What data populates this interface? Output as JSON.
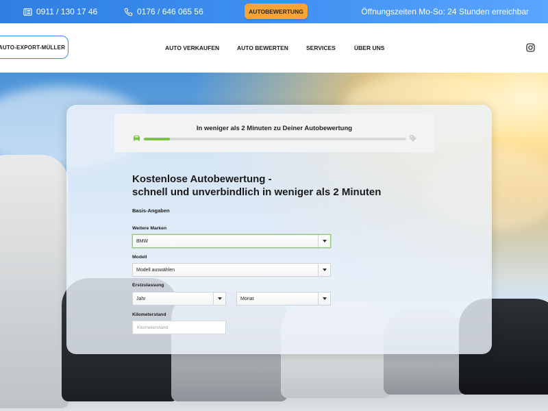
{
  "topbar": {
    "phone1": "0911 / 130 17 46",
    "phone2": "0176 / 646 065 56",
    "cta_label": "AUTOBEWERTUNG",
    "hours": "Öffnungszeiten Mo-So: 24 Stunden erreichbar"
  },
  "nav": {
    "logo_text": "AUTO-EXPORT-MÜLLER",
    "items": [
      "AUTO VERKAUFEN",
      "AUTO BEWERTEN",
      "SERVICES",
      "ÜBER UNS"
    ]
  },
  "progress": {
    "title": "In weniger als 2 Minuten zu Deiner Autobewertung",
    "fraction": 0.1
  },
  "form": {
    "headline_line1": "Kostenlose Autobewertung -",
    "headline_line2": "schnell und unverbindlich in weniger als 2 Minuten",
    "section_title": "Basis-Angaben",
    "brand_label": "Weitere Marken",
    "brand_value": "BMW",
    "model_label": "Modell",
    "model_value": "Modell auswählen",
    "registration_label": "Erstzulassung",
    "year_value": "Jahr",
    "month_value": "Monat",
    "mileage_label": "Kilometerstand",
    "mileage_placeholder": "Kilometerstand"
  },
  "colors": {
    "accent_blue": "#3b8be8",
    "cta_orange": "#f7a436",
    "progress_green": "#7cc243"
  }
}
